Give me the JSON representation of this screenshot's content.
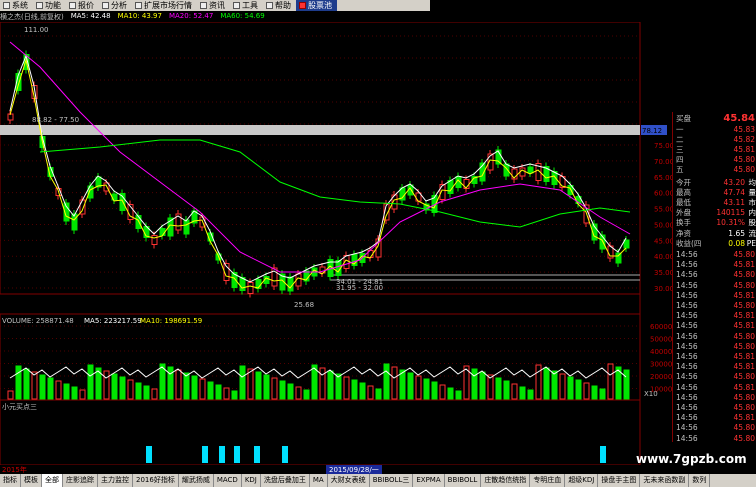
{
  "menu": [
    {
      "label": "系统"
    },
    {
      "label": "功能"
    },
    {
      "label": "报价"
    },
    {
      "label": "分析"
    },
    {
      "label": "扩展市场行情"
    },
    {
      "label": "资讯"
    },
    {
      "label": "工具"
    },
    {
      "label": "帮助"
    },
    {
      "label": "股票池"
    }
  ],
  "info": {
    "title": "横之杰(日线,前复权)",
    "ma5": "MA5: 42.48",
    "ma10": "MA10: 43.97",
    "ma20": "MA20: 52.47",
    "ma60": "MA60: 54.69"
  },
  "price_chart": {
    "annotations": {
      "high": "111.00",
      "range1": "88.82 - 77.50",
      "marker": "78.12",
      "range2": "31.95 - 32.00",
      "low": "25.68",
      "range3": "34.01 - 24.81"
    },
    "axis_labels": [
      "75.00",
      "70.00",
      "65.00",
      "60.00",
      "55.00",
      "50.00",
      "45.00",
      "40.00",
      "35.00",
      "30.00"
    ]
  },
  "volume": {
    "title": "VOLUME: 258871.48",
    "ma5": "MA5: 223217.59",
    "ma10": "MA10: 198691.59",
    "axis_labels": [
      "60000",
      "50000",
      "40000",
      "30000",
      "20000",
      "10000"
    ],
    "unit": "X10"
  },
  "indicator": {
    "title": "小元买点三"
  },
  "date": {
    "selected": "2015/09/28/一",
    "left": "2015年"
  },
  "quote": {
    "price_head": {
      "label": "买盘",
      "value": "45.84"
    },
    "bids": [
      {
        "label": "一",
        "value": "45.83"
      },
      {
        "label": "二",
        "value": "45.82"
      },
      {
        "label": "三",
        "value": "45.81"
      },
      {
        "label": "四",
        "value": "45.80"
      },
      {
        "label": "五",
        "value": "45.80"
      }
    ],
    "stats": [
      {
        "label": "今开",
        "value": "43.20",
        "tail": "均"
      },
      {
        "label": "最高",
        "value": "47.74",
        "tail": "量"
      },
      {
        "label": "最低",
        "value": "43.11",
        "tail": "市"
      },
      {
        "label": "外盘",
        "value": "140115",
        "tail": "内"
      },
      {
        "label": "换手",
        "value": "10.31%",
        "tail": "股"
      },
      {
        "label": "净资",
        "value": "1.65",
        "tail": "流"
      },
      {
        "label": "收益(四",
        "value": "0.08",
        "tail": "PE"
      }
    ],
    "ticks": [
      {
        "time": "14:56",
        "price": "45.80"
      },
      {
        "time": "14:56",
        "price": "45.81"
      },
      {
        "time": "14:56",
        "price": "45.80"
      },
      {
        "time": "14:56",
        "price": "45.80"
      },
      {
        "time": "14:56",
        "price": "45.81"
      },
      {
        "time": "14:56",
        "price": "45.80"
      },
      {
        "time": "14:56",
        "price": "45.81"
      },
      {
        "time": "14:56",
        "price": "45.81"
      },
      {
        "time": "14:56",
        "price": "45.80"
      },
      {
        "time": "14:56",
        "price": "45.80"
      },
      {
        "time": "14:56",
        "price": "45.81"
      },
      {
        "time": "14:56",
        "price": "45.81"
      },
      {
        "time": "14:56",
        "price": "45.80"
      },
      {
        "time": "14:56",
        "price": "45.81"
      },
      {
        "time": "14:56",
        "price": "45.80"
      },
      {
        "time": "14:56",
        "price": "45.80"
      },
      {
        "time": "14:56",
        "price": "45.81"
      },
      {
        "time": "14:56",
        "price": "45.80"
      },
      {
        "time": "14:56",
        "price": "45.80"
      }
    ]
  },
  "tabs": [
    {
      "label": "指标",
      "sel": false
    },
    {
      "label": "模板",
      "sel": false
    },
    {
      "label": "全部",
      "sel": true
    },
    {
      "label": "庄影追踪",
      "sel": false
    },
    {
      "label": "主力监控",
      "sel": false
    },
    {
      "label": "2016好指标",
      "sel": false
    },
    {
      "label": "耀武扬威",
      "sel": false
    },
    {
      "label": "MACD",
      "sel": false
    },
    {
      "label": "KDJ",
      "sel": false
    },
    {
      "label": "洗盘后叠加王",
      "sel": false
    },
    {
      "label": "MA",
      "sel": false
    },
    {
      "label": "大财女表统",
      "sel": false
    },
    {
      "label": "BBIBOLL三",
      "sel": false
    },
    {
      "label": "EXPMA",
      "sel": false
    },
    {
      "label": "BBIBOLL",
      "sel": false
    },
    {
      "label": "庄散趋信统指",
      "sel": false
    },
    {
      "label": "专明庄血",
      "sel": false
    },
    {
      "label": "超级KDJ",
      "sel": false
    },
    {
      "label": "操盘手主图",
      "sel": false
    },
    {
      "label": "无未来函数副",
      "sel": false
    },
    {
      "label": "数列",
      "sel": false
    }
  ],
  "watermark": "www.7gpzb.com",
  "colors": {
    "up": "#ff3232",
    "down": "#00e600",
    "ma5": "#ffffff",
    "ma10": "#ffff00",
    "ma20": "#ff00ff",
    "ma60": "#00ff00",
    "signal": "#00e0ff"
  }
}
